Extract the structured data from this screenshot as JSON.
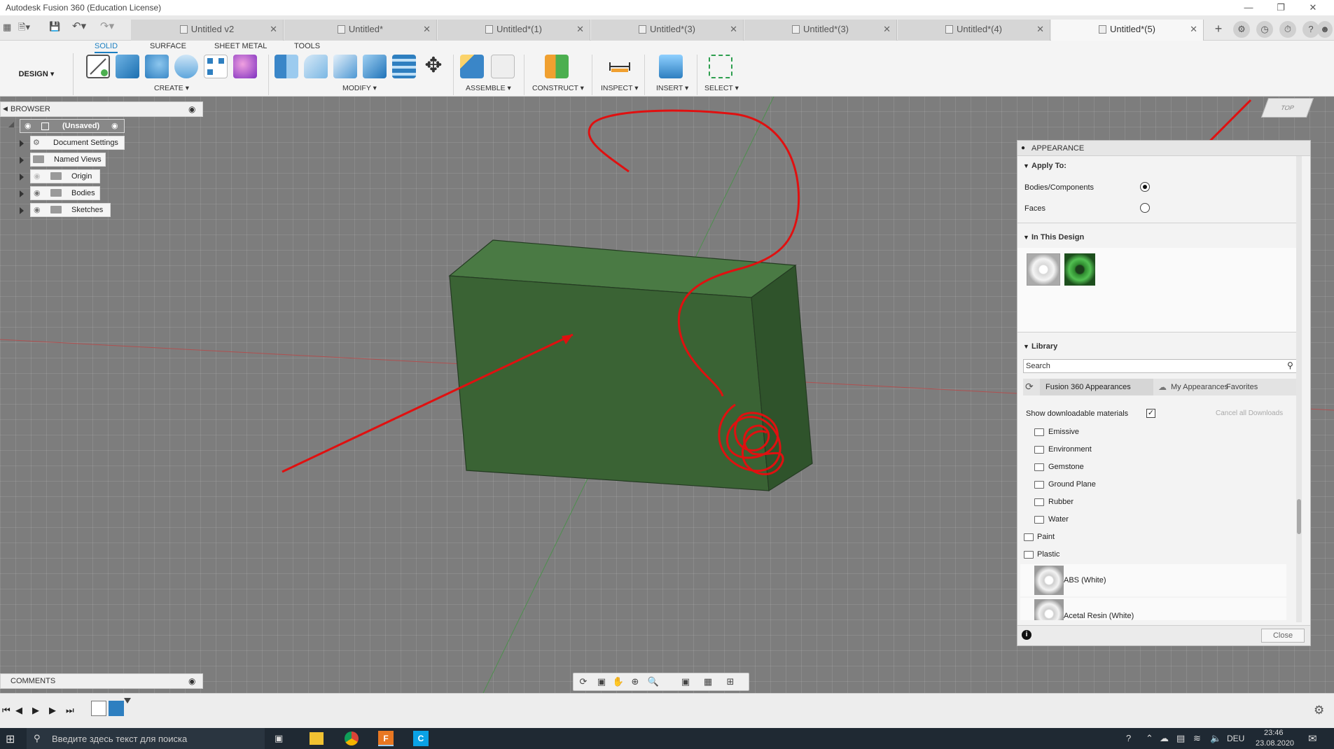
{
  "window": {
    "title": "Autodesk Fusion 360 (Education License)"
  },
  "tabs": [
    {
      "label": "Untitled v2",
      "active": false
    },
    {
      "label": "Untitled*",
      "active": false
    },
    {
      "label": "Untitled*(1)",
      "active": false
    },
    {
      "label": "Untitled*(3)",
      "active": false
    },
    {
      "label": "Untitled*(3)",
      "active": false
    },
    {
      "label": "Untitled*(4)",
      "active": false
    },
    {
      "label": "Untitled*(5)",
      "active": true
    }
  ],
  "ribbon": {
    "workspace": "DESIGN",
    "tabs": [
      "SOLID",
      "SURFACE",
      "SHEET METAL",
      "TOOLS"
    ],
    "groups": [
      "CREATE",
      "MODIFY",
      "ASSEMBLE",
      "CONSTRUCT",
      "INSPECT",
      "INSERT",
      "SELECT"
    ]
  },
  "browser": {
    "title": "BROWSER",
    "root": "(Unsaved)",
    "items": [
      "Document Settings",
      "Named Views",
      "Origin",
      "Bodies",
      "Sketches"
    ]
  },
  "comments": {
    "title": "COMMENTS"
  },
  "viewcube": {
    "face": "TOP"
  },
  "appearance": {
    "title": "APPEARANCE",
    "apply_to": {
      "heading": "Apply To:",
      "options": [
        {
          "label": "Bodies/Components",
          "selected": true
        },
        {
          "label": "Faces",
          "selected": false
        }
      ]
    },
    "in_this_design": {
      "heading": "In This Design",
      "swatches": [
        "white-material-swatch",
        "green-material-swatch"
      ]
    },
    "library": {
      "heading": "Library",
      "search_placeholder": "Search",
      "tabs": [
        "Fusion 360 Appearances",
        "My Appearances",
        "Favorites"
      ],
      "show_downloadable": "Show downloadable materials",
      "show_downloadable_checked": true,
      "cancel_downloads": "Cancel all Downloads",
      "subfolders": [
        "Emissive",
        "Environment",
        "Gemstone",
        "Ground Plane",
        "Rubber",
        "Water"
      ],
      "folders": [
        "Paint",
        "Plastic"
      ],
      "materials": [
        "ABS (White)",
        "Acetal Resin (White)"
      ]
    },
    "close_label": "Close"
  },
  "taskbar": {
    "search_placeholder": "Введите здесь текст для поиска",
    "lang": "DEU",
    "time": "23:46",
    "date": "23.08.2020"
  },
  "colors": {
    "accent": "#1b7fc1",
    "body_green": "#3f6b3a",
    "annotation_red": "#e01010",
    "viewport_bg": "#7d7d7d"
  }
}
